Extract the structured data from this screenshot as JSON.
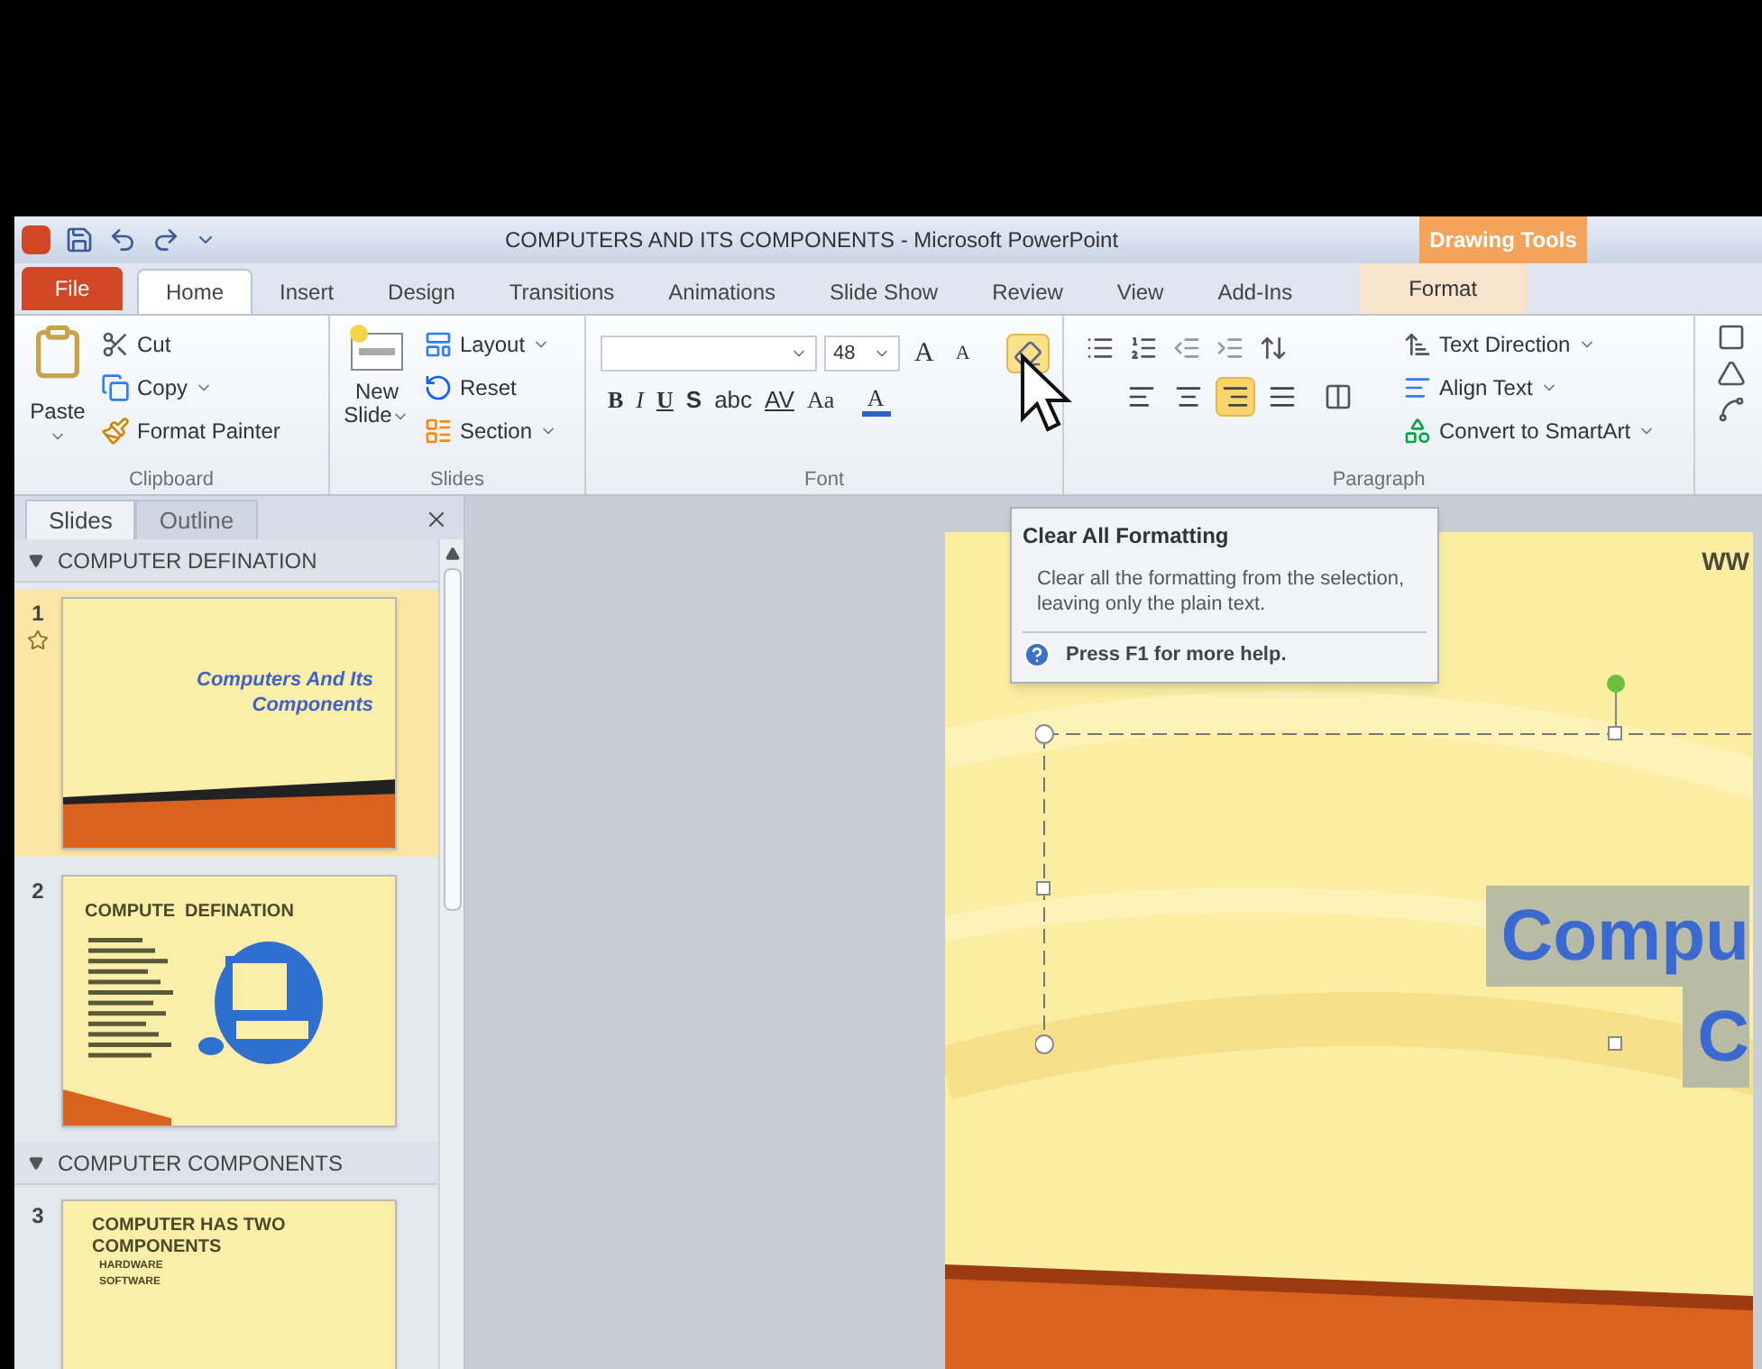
{
  "window": {
    "title": "COMPUTERS AND ITS COMPONENTS - Microsoft PowerPoint",
    "contextual_group": "Drawing Tools"
  },
  "tabs": [
    {
      "label": "File",
      "kind": "file",
      "selected": false
    },
    {
      "label": "Home",
      "kind": "tab",
      "selected": true
    },
    {
      "label": "Insert",
      "kind": "tab",
      "selected": false
    },
    {
      "label": "Design",
      "kind": "tab",
      "selected": false
    },
    {
      "label": "Transitions",
      "kind": "tab",
      "selected": false
    },
    {
      "label": "Animations",
      "kind": "tab",
      "selected": false
    },
    {
      "label": "Slide Show",
      "kind": "tab",
      "selected": false
    },
    {
      "label": "Review",
      "kind": "tab",
      "selected": false
    },
    {
      "label": "View",
      "kind": "tab",
      "selected": false
    },
    {
      "label": "Add-Ins",
      "kind": "tab",
      "selected": false
    },
    {
      "label": "Format",
      "kind": "contextual",
      "selected": false
    }
  ],
  "clipboard": {
    "label": "Clipboard",
    "paste": "Paste",
    "items": [
      {
        "label": "Cut",
        "kind": "cut",
        "dropdown": false
      },
      {
        "label": "Copy",
        "kind": "copy",
        "dropdown": true
      },
      {
        "label": "Format Painter",
        "kind": "painter",
        "dropdown": false
      }
    ]
  },
  "slides_group": {
    "label": "Slides",
    "new_slide": [
      "New",
      "Slide"
    ],
    "items": [
      {
        "label": "Layout",
        "kind": "layout",
        "dropdown": true
      },
      {
        "label": "Reset",
        "kind": "reset",
        "dropdown": false
      },
      {
        "label": "Section",
        "kind": "section",
        "dropdown": true
      }
    ]
  },
  "font": {
    "label": "Font",
    "size": "48",
    "grow": "A",
    "shrink": "A",
    "styles": [
      {
        "label": "B",
        "kind": "bold"
      },
      {
        "label": "I",
        "kind": "italic"
      },
      {
        "label": "U",
        "kind": "underline"
      },
      {
        "label": "S",
        "kind": "shadow"
      },
      {
        "label": "abc",
        "kind": "strike"
      },
      {
        "label": "AV",
        "kind": "spacing"
      },
      {
        "label": "Aa",
        "kind": "case"
      },
      {
        "label": "A",
        "kind": "color",
        "color": "#2f62c8"
      }
    ],
    "clear_formatting": {
      "hovered": true
    }
  },
  "paragraph": {
    "label": "Paragraph",
    "alignments": [
      {
        "kind": "left",
        "selected": false
      },
      {
        "kind": "center",
        "selected": false
      },
      {
        "kind": "right",
        "selected": true
      },
      {
        "kind": "justify",
        "selected": false
      }
    ],
    "commands": [
      {
        "label": "Text Direction",
        "kind": "direction"
      },
      {
        "label": "Align Text",
        "kind": "align"
      },
      {
        "label": "Convert to SmartArt",
        "kind": "smartart"
      }
    ]
  },
  "pane": {
    "tabs": [
      {
        "label": "Slides",
        "selected": true
      },
      {
        "label": "Outline",
        "selected": false
      }
    ],
    "sections": [
      {
        "title": "COMPUTER DEFINATION",
        "slides": [
          {
            "number": "1",
            "kind": "title",
            "selected": true,
            "animated": true,
            "lines": [
              "Computers And Its",
              "Components"
            ]
          },
          {
            "number": "2",
            "kind": "picture",
            "selected": false,
            "animated": false,
            "lines": [
              "COMPUTE  DEFINATION"
            ]
          }
        ]
      },
      {
        "title": "COMPUTER COMPONENTS",
        "slides": [
          {
            "number": "3",
            "kind": "bullets",
            "selected": false,
            "animated": false,
            "lines": [
              "COMPUTER HAS TWO",
              "COMPONENTS"
            ],
            "bullets": [
              "HARDWARE",
              "SOFTWARE"
            ]
          }
        ]
      }
    ]
  },
  "tooltip": {
    "title": "Clear All Formatting",
    "body": "Clear all the formatting from the selection, leaving only the plain text.",
    "help": "Press F1 for more help."
  },
  "slide": {
    "corner_text": "WW",
    "title_lines": [
      "Compu",
      "C"
    ]
  }
}
